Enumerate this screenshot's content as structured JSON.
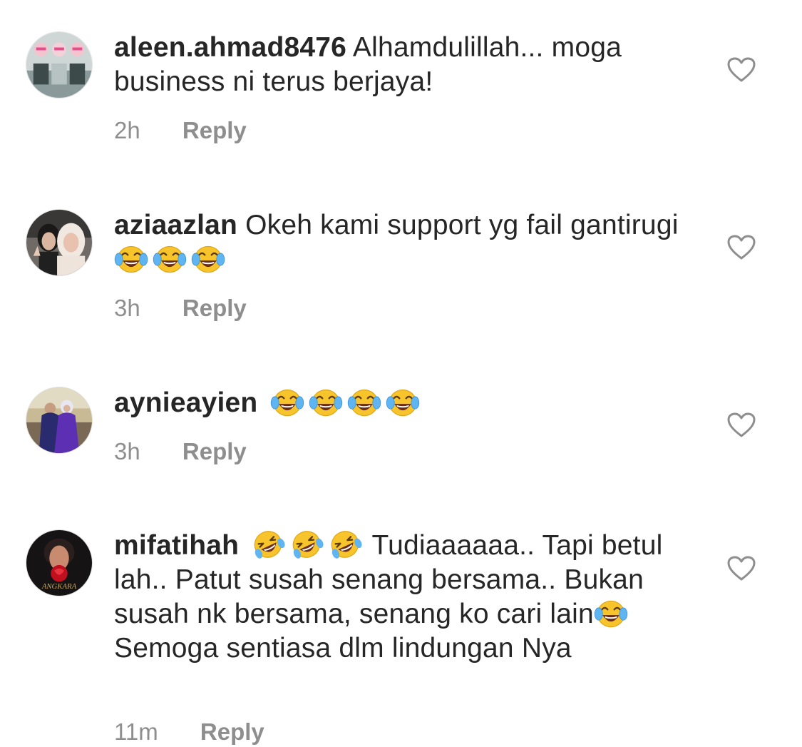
{
  "comments": [
    {
      "username": "aleen.ahmad8476",
      "text": "Alhamdulillah... moga business ni terus berjaya!",
      "time": "2h",
      "reply_label": "Reply",
      "avatar_icon": "avatar-three-girls-pink-hijab",
      "like_icon": "heart-outline-icon"
    },
    {
      "username": "aziaazlan",
      "text_before": "Okeh kami support yg fail gantirugi",
      "emojis": [
        "laugh-tears-emoji",
        "laugh-tears-emoji",
        "laugh-tears-emoji"
      ],
      "time": "3h",
      "reply_label": "Reply",
      "avatar_icon": "avatar-two-women-selfie",
      "like_icon": "heart-outline-icon"
    },
    {
      "username": "aynieayien",
      "emojis": [
        "laugh-tears-emoji",
        "laugh-tears-emoji",
        "laugh-tears-emoji",
        "laugh-tears-emoji"
      ],
      "time": "3h",
      "reply_label": "Reply",
      "avatar_icon": "avatar-couple-purple",
      "like_icon": "heart-outline-icon"
    },
    {
      "username": "mifatihah",
      "emojis_before": [
        "rolling-laugh-emoji",
        "rolling-laugh-emoji",
        "rolling-laugh-emoji"
      ],
      "text_part1": "Tudiaaaaaa.. Tapi betul lah.. Patut susah senang bersama.. Bukan susah nk bersama, senang ko cari lain",
      "emoji_middle": "laugh-tears-emoji",
      "text_part2": "Semoga sentiasa dlm lindungan Nya",
      "time": "11m",
      "reply_label": "Reply",
      "avatar_icon": "avatar-angkara-poster",
      "like_icon": "heart-outline-icon"
    }
  ],
  "colors": {
    "text": "#262626",
    "meta": "#8e8e8e",
    "heart_stroke": "#8e8e8e",
    "emoji_face": "#f7c52b"
  }
}
